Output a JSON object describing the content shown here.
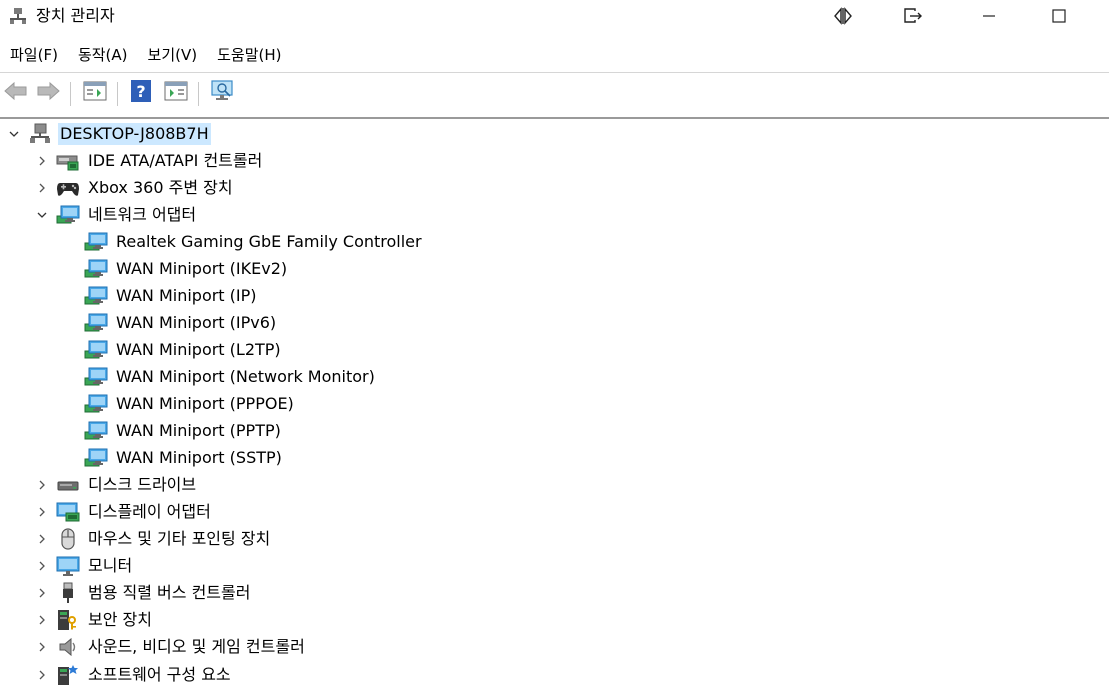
{
  "window": {
    "title": "장치 관리자"
  },
  "menu": [
    "파일(F)",
    "동작(A)",
    "보기(V)",
    "도움말(H)"
  ],
  "tree": {
    "root": "DESKTOP-J808B7H",
    "items": [
      {
        "label": "IDE ATA/ATAPI 컨트롤러",
        "icon": "ide-controller-icon",
        "expanded": false
      },
      {
        "label": "Xbox 360 주변 장치",
        "icon": "gamepad-icon",
        "expanded": false
      },
      {
        "label": "네트워크 어댑터",
        "icon": "network-adapter-icon",
        "expanded": true,
        "children": [
          "Realtek Gaming GbE Family Controller",
          "WAN Miniport (IKEv2)",
          "WAN Miniport (IP)",
          "WAN Miniport (IPv6)",
          "WAN Miniport (L2TP)",
          "WAN Miniport (Network Monitor)",
          "WAN Miniport (PPPOE)",
          "WAN Miniport (PPTP)",
          "WAN Miniport (SSTP)"
        ]
      },
      {
        "label": "디스크 드라이브",
        "icon": "disk-drive-icon",
        "expanded": false
      },
      {
        "label": "디스플레이 어댑터",
        "icon": "display-adapter-icon",
        "expanded": false
      },
      {
        "label": "마우스 및 기타 포인팅 장치",
        "icon": "mouse-icon",
        "expanded": false
      },
      {
        "label": "모니터",
        "icon": "monitor-icon",
        "expanded": false
      },
      {
        "label": "범용 직렬 버스 컨트롤러",
        "icon": "usb-icon",
        "expanded": false
      },
      {
        "label": "보안 장치",
        "icon": "security-key-icon",
        "expanded": false
      },
      {
        "label": "사운드, 비디오 및 게임 컨트롤러",
        "icon": "speaker-icon",
        "expanded": false
      },
      {
        "label": "소프트웨어 구성 요소",
        "icon": "software-component-icon",
        "expanded": false
      }
    ]
  },
  "colors": {
    "selection": "#cce8ff",
    "netBlue": "#1e88e5",
    "netGreen": "#3aa655"
  }
}
